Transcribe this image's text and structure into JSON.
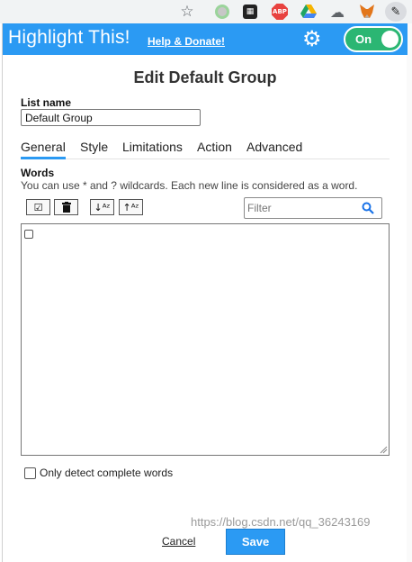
{
  "browser": {
    "extensions": [
      "star-icon",
      "extension-circle-icon",
      "extension-dark-icon",
      "adblock-icon",
      "drive-icon",
      "cloud-icon",
      "metamask-fox-icon",
      "highlighter-pen-icon"
    ],
    "abp_text": "ABP"
  },
  "header": {
    "app_title": "Highlight This!",
    "help_link": "Help & Donate!",
    "toggle_label": "On",
    "colors": {
      "header_bg": "#2b9af3",
      "toggle_bg": "#2bb673"
    }
  },
  "dialog": {
    "title": "Edit Default Group",
    "list_name_label": "List name",
    "list_name_value": "Default Group",
    "tabs": [
      {
        "label": "General",
        "active": true
      },
      {
        "label": "Style",
        "active": false
      },
      {
        "label": "Limitations",
        "active": false
      },
      {
        "label": "Action",
        "active": false
      },
      {
        "label": "Advanced",
        "active": false
      }
    ],
    "words_label": "Words",
    "words_hint": "You can use * and ? wildcards. Each new line is considered as a word.",
    "toolbar": [
      "select-all-icon",
      "trash-icon",
      "sort-ascending-icon",
      "sort-descending-icon"
    ],
    "filter_placeholder": "Filter",
    "complete_words_label": "Only detect complete words",
    "complete_words_checked": false,
    "cancel_label": "Cancel",
    "save_label": "Save"
  },
  "watermark": "https://blog.csdn.net/qq_36243169"
}
